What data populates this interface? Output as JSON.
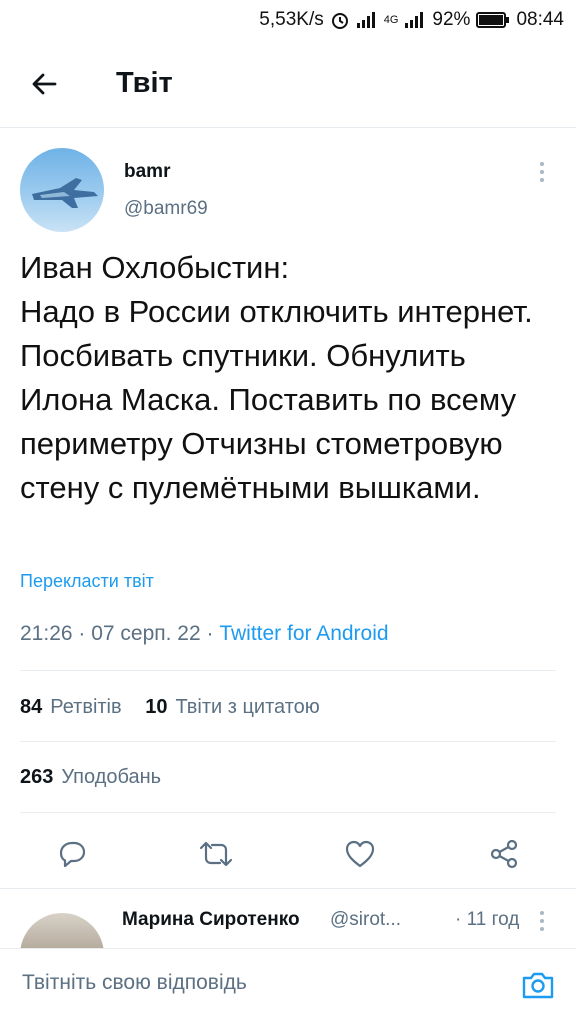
{
  "status_bar": {
    "net_speed": "5,53K/s",
    "network": "4G",
    "battery": "92%",
    "time": "08:44",
    "icons": [
      "alarm-icon",
      "signal-icon",
      "signal-4g-icon",
      "battery-icon"
    ]
  },
  "header": {
    "title": "Твіт",
    "back_icon": "arrow-left-icon"
  },
  "tweet": {
    "author_name": "bamr",
    "author_handle": "@bamr69",
    "text": "Иван Охлобыстин:\nНадо в России отключить интернет. Посбивать спутники. Обнулить Илона Маска. Поставить по всему периметру Отчизны стометровую стену с пулемётными вышками.",
    "translate_label": "Перекласти твіт",
    "timestamp": "21:26 · 07 серп. 22 · ",
    "source": "Twitter for Android",
    "retweets_count": "84",
    "retweets_label": "Ретвітів",
    "quotes_count": "10",
    "quotes_label": "Твіти з цитатою",
    "likes_count": "263",
    "likes_label": "Уподобань"
  },
  "actions": [
    "reply-icon",
    "retweet-icon",
    "like-icon",
    "share-icon"
  ],
  "reply_preview": {
    "name": "Марина Сиротенко",
    "handle": "@sirot...",
    "time": "· 11 год"
  },
  "composer": {
    "placeholder": "Твітніть свою відповідь",
    "camera_icon": "camera-icon"
  },
  "colors": {
    "accent": "#1d9bf0",
    "secondary_text": "#5b7083",
    "divider": "#e6ecf0"
  }
}
